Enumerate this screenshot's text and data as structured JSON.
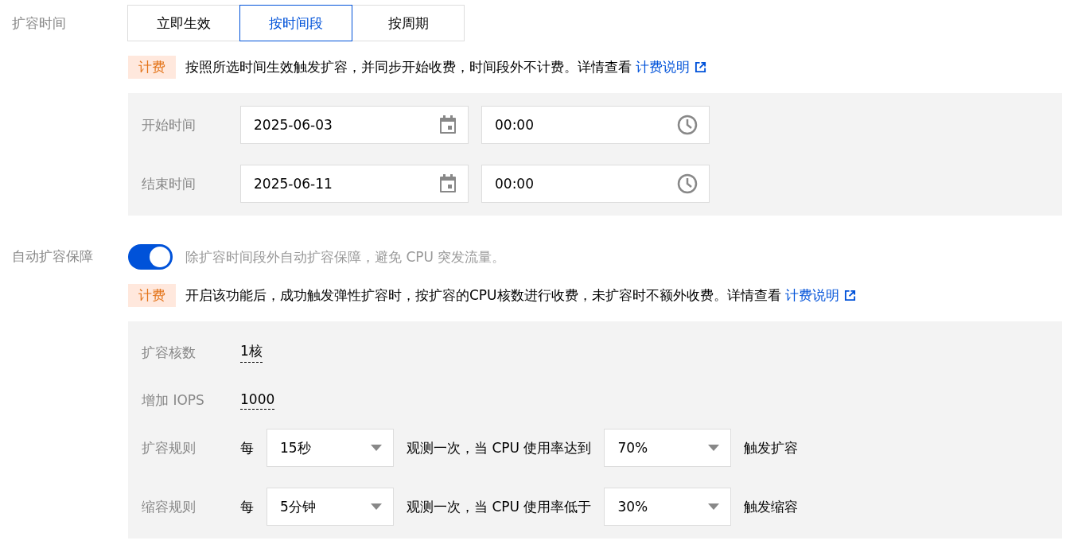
{
  "scale_time": {
    "label": "扩容时间",
    "options": [
      {
        "label": "立即生效",
        "selected": false
      },
      {
        "label": "按时间段",
        "selected": true
      },
      {
        "label": "按周期",
        "selected": false
      }
    ],
    "billing": {
      "tag": "计费",
      "text": "按照所选时间生效触发扩容，并同步开始收费，时间段外不计费。详情查看",
      "link": "计费说明"
    },
    "ranges": [
      {
        "label": "开始时间",
        "date": "2025-06-03",
        "time": "00:00"
      },
      {
        "label": "结束时间",
        "date": "2025-06-11",
        "time": "00:00"
      }
    ]
  },
  "auto_guarantee": {
    "label": "自动扩容保障",
    "on": true,
    "description": "除扩容时间段外自动扩容保障，避免 CPU 突发流量。",
    "billing": {
      "tag": "计费",
      "text": "开启该功能后，成功触发弹性扩容时，按扩容的CPU核数进行收费，未扩容时不额外收费。详情查看",
      "link": "计费说明"
    },
    "settings": [
      {
        "label": "扩容核数",
        "value": "1核"
      },
      {
        "label": "增加 IOPS",
        "value": "1000"
      }
    ],
    "rules": [
      {
        "label": "扩容规则",
        "prefix": "每",
        "interval": "15秒",
        "middle": "观测一次，当 CPU 使用率达到",
        "threshold": "70%",
        "suffix": "触发扩容"
      },
      {
        "label": "缩容规则",
        "prefix": "每",
        "interval": "5分钟",
        "middle": "观测一次，当 CPU 使用率低于",
        "threshold": "30%",
        "suffix": "触发缩容"
      }
    ]
  }
}
